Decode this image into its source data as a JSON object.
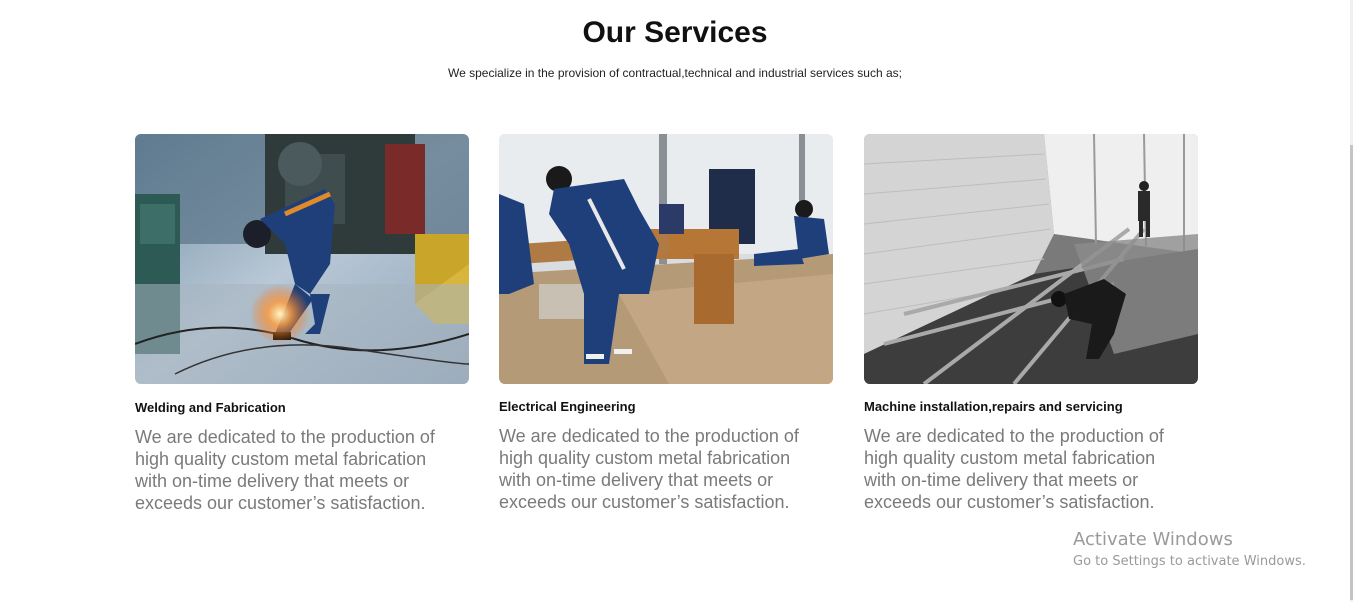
{
  "header": {
    "title": "Our Services",
    "subtitle": "We specialize in the provision of contractual,technical and industrial services such as;"
  },
  "services": [
    {
      "title": "Welding and Fabrication",
      "description": "We are dedicated to the production of high quality custom metal fabrication with on-time delivery that meets or exceeds our customer’s satisfaction."
    },
    {
      "title": "Electrical Engineering",
      "description": "We are dedicated to the production of high quality custom metal fabrication with on-time delivery that meets or exceeds our customer’s satisfaction."
    },
    {
      "title": "Machine installation,repairs and servicing",
      "description": "We are dedicated to the production of high quality custom metal fabrication with on-time delivery that meets or exceeds our customer’s satisfaction."
    }
  ],
  "watermark": {
    "title": "Activate Windows",
    "subtitle": "Go to Settings to activate Windows."
  }
}
